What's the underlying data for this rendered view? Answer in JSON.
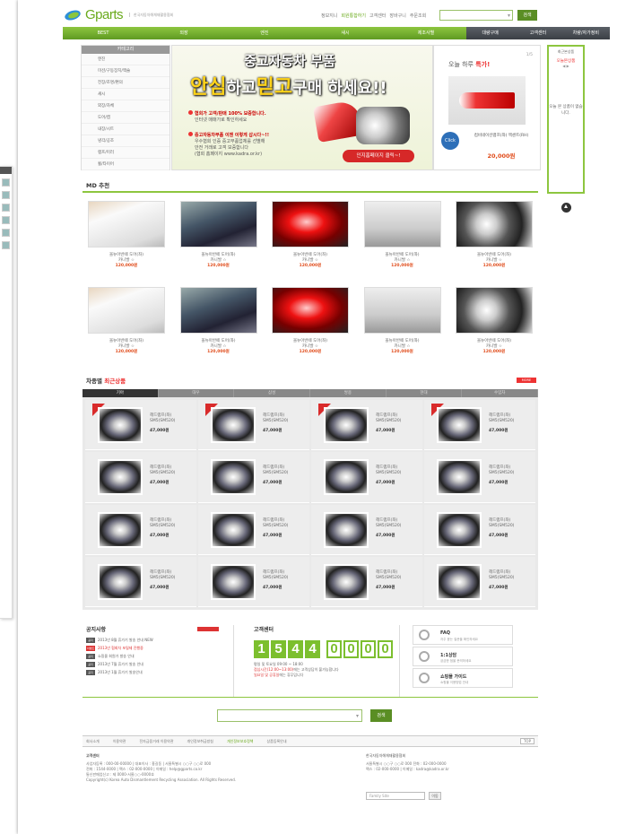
{
  "header": {
    "logo_text": "Gparts",
    "logo_sub": "한국자동차해체재활용협회",
    "links": [
      "정보지니",
      "회원통합하기",
      "고객센터",
      "장바구니",
      "주문조회"
    ],
    "search_placeholder": "",
    "search_button": "검색"
  },
  "nav": {
    "green": [
      "BEST",
      "외장",
      "엔진",
      "섀시",
      "제조사별"
    ],
    "dark": [
      "대량구매",
      "고객센터",
      "차량/자가정비"
    ]
  },
  "sidebar": {
    "title": "카테고리",
    "items": [
      "엔진",
      "미션/구동장치/액슬",
      "전장/조명/편의",
      "섀시",
      "외장/차체",
      "도어/캡",
      "내장/시트",
      "냉각/공조",
      "램프/미러",
      "휠/타이어",
      "바디/차체/외장"
    ]
  },
  "banner": {
    "title1": "중고자동차 부품",
    "title2_a": "안심",
    "title2_b": "하고",
    "title2_c": "믿고",
    "title2_d": "구매 하세요!!",
    "line1_head": "협회가 고객/판매 100% 보증합니다.",
    "line1_sub": "인터넷 매매가로 확인하세요",
    "line2_head": "중고자동차부품 이젠 이렇게 삽시다~!!",
    "line2_sub1": "우수협회 인증 중고부품업체를 선별해",
    "line2_sub2": "안전 거래로 고객 보증합니다",
    "line2_sub3": "(협회 홈페이지 www.kadra.or.kr)",
    "button": "인지홈페이지 클릭~!"
  },
  "today": {
    "title_a": "오늘 하루",
    "title_b": "특가!",
    "pager": "1/5",
    "click": "Click",
    "name": "컴비네이션램프(좌) 엑센트(RH)",
    "price": "20,000원"
  },
  "recent": {
    "title": "최근본상품",
    "sub": "오늘본상품",
    "arrows": "◀  ▶",
    "empty": "오늘 본 상품이 없습니다."
  },
  "md": {
    "title": "MD 추천",
    "items": [
      {
        "name": "올뉴아반떼 도어(좌)",
        "sub": "카니발 ☆",
        "price": "120,000원",
        "img": "door"
      },
      {
        "name": "올뉴아반떼 도어(좌)",
        "sub": "카니발 ☆",
        "price": "120,000원",
        "img": "fender"
      },
      {
        "name": "올뉴아반떼 도어(좌)",
        "sub": "카니발 ☆",
        "price": "120,000원",
        "img": "tail"
      },
      {
        "name": "올뉴아반떼 도어(좌)",
        "sub": "카니발 ☆",
        "price": "120,000원",
        "img": "hood"
      },
      {
        "name": "올뉴아반떼 도어(좌)",
        "sub": "카니발 ☆",
        "price": "120,000원",
        "img": "head"
      },
      {
        "name": "올뉴아반떼 도어(좌)",
        "sub": "카니발 ☆",
        "price": "120,000원",
        "img": "door"
      },
      {
        "name": "올뉴아반떼 도어(좌)",
        "sub": "카니발 ☆",
        "price": "120,000원",
        "img": "fender"
      },
      {
        "name": "올뉴아반떼 도어(좌)",
        "sub": "카니발 ☆",
        "price": "120,000원",
        "img": "tail"
      },
      {
        "name": "올뉴아반떼 도어(좌)",
        "sub": "카니발 ☆",
        "price": "120,000원",
        "img": "hood"
      },
      {
        "name": "올뉴아반떼 도어(좌)",
        "sub": "카니발 ☆",
        "price": "120,000원",
        "img": "head"
      }
    ]
  },
  "recent_goods": {
    "title_a": "차종별",
    "title_b": "최근상품",
    "more": "MORE",
    "tabs": [
      "기아",
      "대우",
      "삼성",
      "쌍용",
      "현대",
      "수입차"
    ],
    "item": {
      "name1": "헤드램프(좌)",
      "name2": "SM5(SM520)",
      "price": "47,000원"
    }
  },
  "notice": {
    "title": "공지사항",
    "items": [
      {
        "badge": "공지",
        "text": "2013년 8월 휴가기 발송 안내 NEW",
        "red": false
      },
      {
        "badge": "이벤트",
        "text": "2013년 협회차 포털제 진행중",
        "red": true
      },
      {
        "badge": "공지",
        "text": "쇼핑몰 회원가 발송 안내",
        "red": false
      },
      {
        "badge": "공지",
        "text": "2013년 7월 휴가기 발송 안내",
        "red": false
      },
      {
        "badge": "공지",
        "text": "2013년 1월 휴가기 발송안내",
        "red": false
      }
    ]
  },
  "cs": {
    "title": "고객센터",
    "digits_a": [
      "1",
      "5",
      "4",
      "4"
    ],
    "digits_b": [
      "0",
      "0",
      "0",
      "0"
    ],
    "hours1": "평일 및 토요일 09:00 ~ 18:00",
    "hours2_red": "점심시간(12:00~13:00)",
    "hours2": "에는 고객상담이 불가능합니다",
    "hours3_red": "일요일 및 공휴일",
    "hours3": "에는 휴무입니다"
  },
  "faq": [
    {
      "title": "FAQ",
      "sub": "자주 묻는 질문을 확인하세요"
    },
    {
      "title": "1:1상담",
      "sub": "궁금한 점을 문의하세요"
    },
    {
      "title": "쇼핑몰 가이드",
      "sub": "쇼핑몰 이용방법 안내"
    }
  ],
  "footer": {
    "search_button": "검색",
    "links": [
      "회사소개",
      "이용약관",
      "전자금융거래 이용약관",
      "개인정보취급방침",
      "개인정보보호정책",
      "상품등록안내"
    ],
    "top": "TOP",
    "company_title": "고객센터",
    "company_lines": [
      "사업자등록 : 000-00-00000 | 대표이사 : 홍길동 | 서울특별시 ○○구 ○○로 000",
      "전화 : 1544-0000 | 팩스 : 02-000-0000 | 이메일 : help@gparts.co.kr",
      "통신판매업신고 : 제 0000-서울○○-0000호",
      "Copyright(c) Korea Auto Dismantlement Recycling Association. All Rights Reserved."
    ],
    "assoc_title": "한국자동차해체재활용협회",
    "assoc_lines": [
      "서울특별시 ○○구 ○○로 000 전화 : 02-000-0000",
      "팩스 : 02-000-0000 | 이메일 : kadra@kadra.or.kr"
    ],
    "family_select": "Family Site",
    "go": "이동"
  }
}
